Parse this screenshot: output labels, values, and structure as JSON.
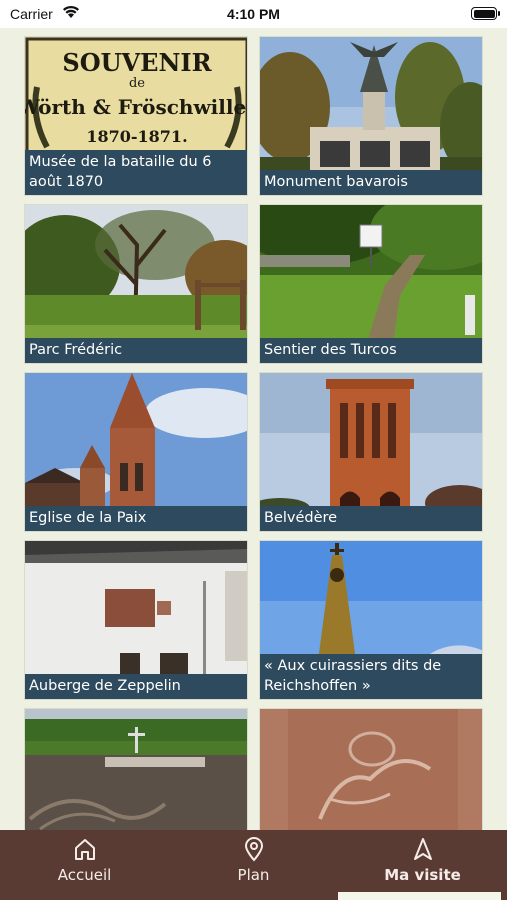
{
  "status_bar": {
    "carrier": "Carrier",
    "time": "4:10 PM"
  },
  "places": [
    {
      "name": "Musée de la bataille du 6 août 1870",
      "icon": "souvenir-poster-photo",
      "poster_text": [
        "SOUVENIR",
        "de",
        "Wörth & Fröschwiller",
        "1870-1871."
      ]
    },
    {
      "name": "Monument bavarois",
      "icon": "monument-statue-photo"
    },
    {
      "name": "Parc Frédéric",
      "icon": "park-tree-photo"
    },
    {
      "name": "Sentier des Turcos",
      "icon": "trail-stairs-photo"
    },
    {
      "name": "Eglise de la Paix",
      "icon": "church-photo"
    },
    {
      "name": "Belvédère",
      "icon": "tower-photo"
    },
    {
      "name": "Auberge de Zeppelin",
      "icon": "building-wall-photo"
    },
    {
      "name": "« Aux cuirassiers dits de Reichshoffen »",
      "icon": "obelisk-photo"
    },
    {
      "name": "",
      "icon": "cemetery-photo"
    },
    {
      "name": "",
      "icon": "stone-relief-photo"
    }
  ],
  "tab_bar": {
    "tabs": [
      {
        "label": "Accueil",
        "icon": "home-icon"
      },
      {
        "label": "Plan",
        "icon": "map-pin-icon"
      },
      {
        "label": "Ma visite",
        "icon": "navigation-arrow-icon",
        "active": true
      }
    ]
  },
  "colors": {
    "caption_bg": "#2e4a5e",
    "tab_bar_bg": "#5a3b33",
    "content_bg": "#eef1e2"
  }
}
